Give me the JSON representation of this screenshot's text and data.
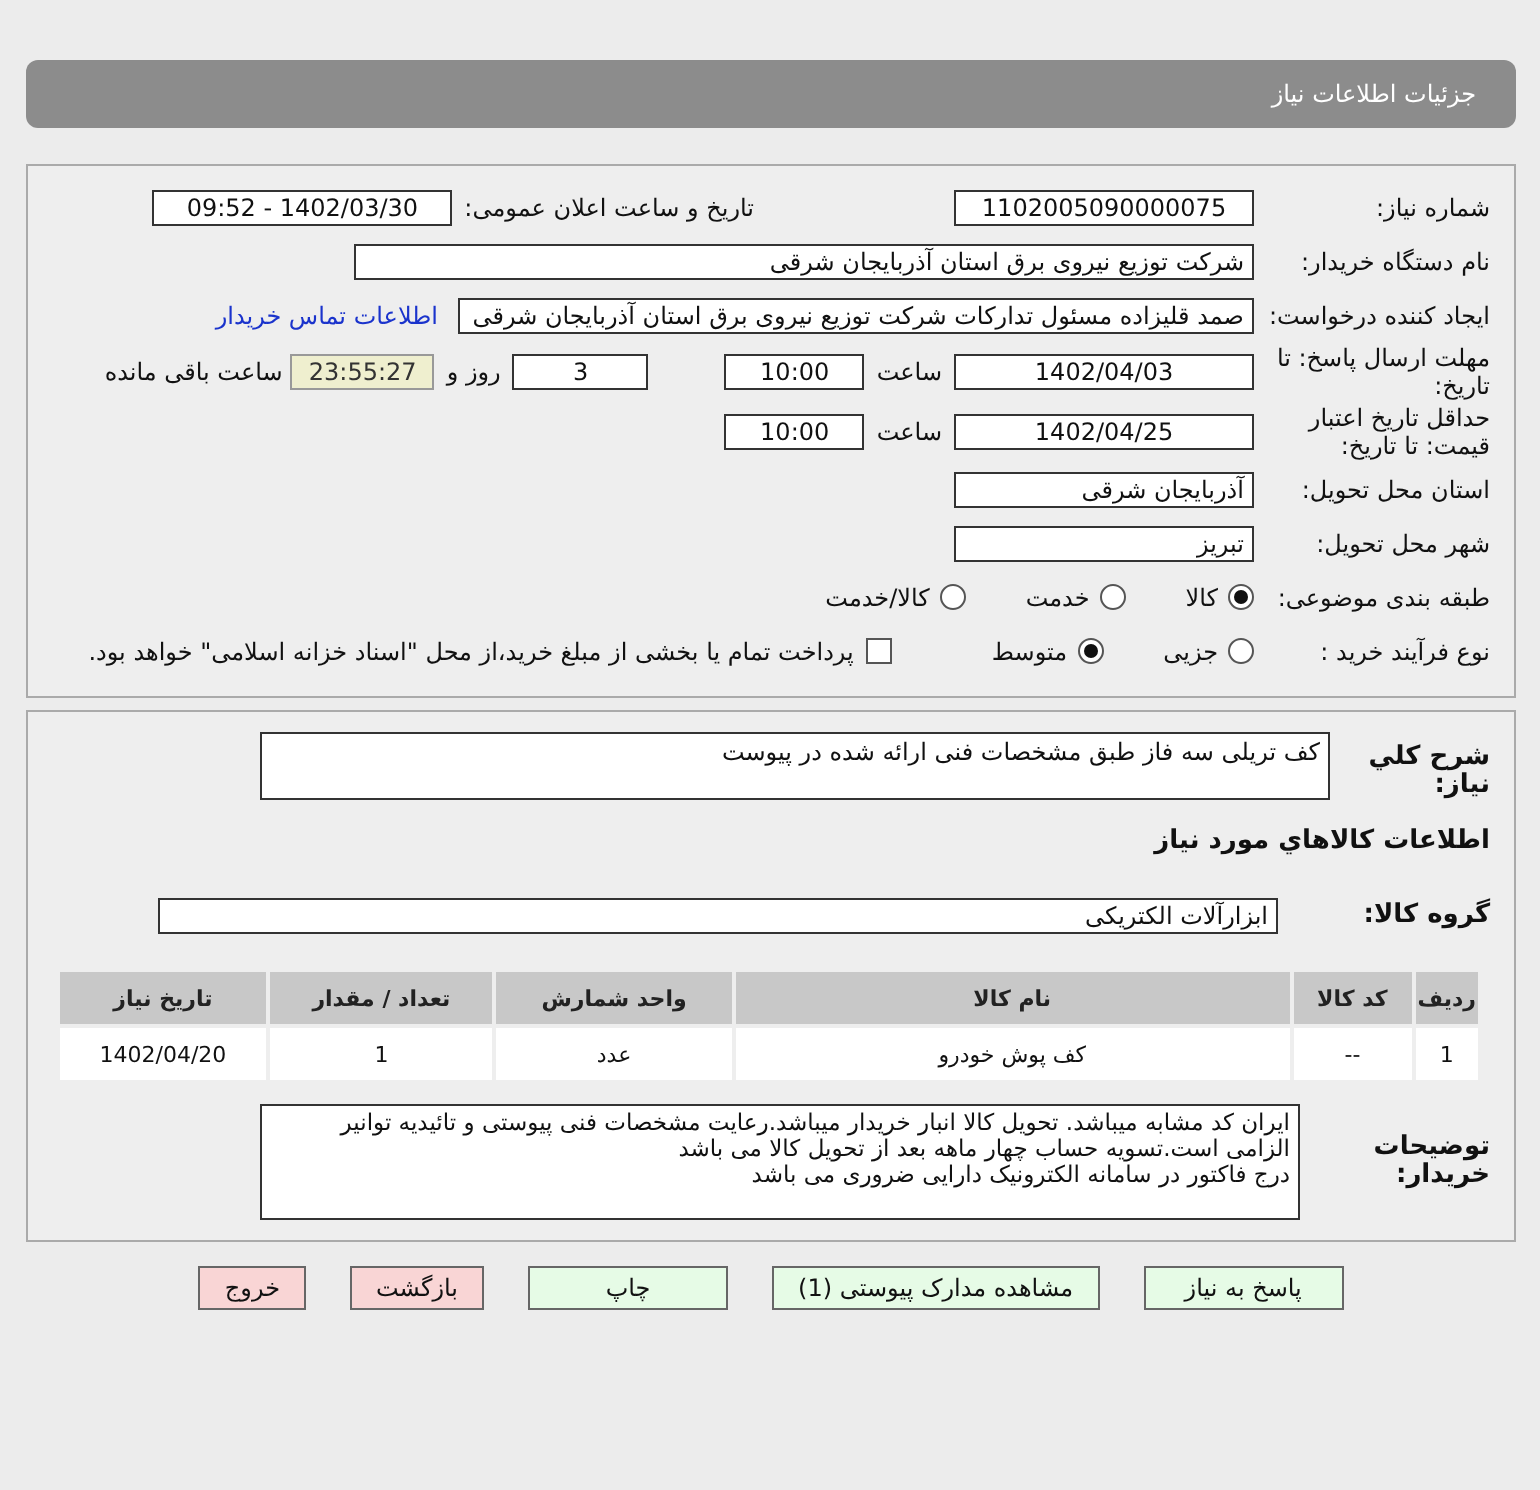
{
  "header": {
    "title": "جزئیات اطلاعات نیاز"
  },
  "need_number": {
    "label": "شماره نیاز:",
    "value": "1102005090000075"
  },
  "announce": {
    "label": "تاریخ و ساعت اعلان عمومی:",
    "value": "1402/03/30 - 09:52"
  },
  "buyer_org": {
    "label": "نام دستگاه خریدار:",
    "value": "شرکت توزیع نیروی برق استان آذربایجان شرقی"
  },
  "requester": {
    "label": "ایجاد کننده درخواست:",
    "value": "صمد  قلیزاده مسئول تدارکات شرکت توزیع نیروی برق استان آذربایجان شرقی",
    "link": "اطلاعات تماس خریدار"
  },
  "deadline": {
    "label": "مهلت ارسال پاسخ: تا تاریخ:",
    "date": "1402/04/03",
    "time_label": "ساعت",
    "time": "10:00",
    "days": "3",
    "days_label": "روز و",
    "remaining": "23:55:27",
    "remaining_label": "ساعت باقی مانده"
  },
  "validity": {
    "label": "حداقل تاریخ اعتبار قیمت: تا تاریخ:",
    "date": "1402/04/25",
    "time_label": "ساعت",
    "time": "10:00"
  },
  "province": {
    "label": "استان محل تحویل:",
    "value": "آذربایجان شرقی"
  },
  "city": {
    "label": "شهر محل تحویل:",
    "value": "تبریز"
  },
  "category": {
    "label": "طبقه بندی موضوعی:",
    "options": [
      {
        "label": "کالا",
        "selected": true
      },
      {
        "label": "خدمت",
        "selected": false
      },
      {
        "label": "کالا/خدمت",
        "selected": false
      }
    ]
  },
  "process": {
    "label": "نوع فرآیند خرید :",
    "options": [
      {
        "label": "جزیی",
        "selected": false
      },
      {
        "label": "متوسط",
        "selected": true
      }
    ],
    "payment": {
      "checked": false,
      "label": "پرداخت تمام یا بخشی از مبلغ خرید،از محل \"اسناد خزانه اسلامی\" خواهد بود."
    }
  },
  "description": {
    "label": "شرح كلي نياز:",
    "value": "کف تریلی سه فاز طبق مشخصات فنی ارائه شده در پیوست"
  },
  "goods": {
    "title": "اطلاعات كالاهاي مورد نياز",
    "group_label": "گروه کالا:",
    "group_value": "ابزارآلات الکتریکی"
  },
  "table": {
    "columns": [
      "ردیف",
      "کد کالا",
      "نام کالا",
      "واحد شمارش",
      "تعداد / مقدار",
      "تاریخ نیاز"
    ],
    "rows": [
      [
        "1",
        "--",
        "کف پوش خودرو",
        "عدد",
        "1",
        "1402/04/20"
      ]
    ]
  },
  "buyer_notes": {
    "label": "توضیحات خریدار:",
    "lines": [
      "ایران کد مشابه میباشد. تحویل کالا انبار خریدار میباشد.رعایت مشخصات فنی پیوستی و تائیدیه توانیر الزامی است.تسویه حساب چهار ماهه بعد از تحویل کالا می باشد",
      "درج فاکتور در سامانه الکترونیک دارایی ضروری می باشد"
    ]
  },
  "buttons": [
    {
      "label": "پاسخ به نیاز",
      "kind": "green"
    },
    {
      "label": "مشاهده مدارک پیوستی (1)",
      "kind": "green"
    },
    {
      "label": "چاپ",
      "kind": "green"
    },
    {
      "label": "بازگشت",
      "kind": "red"
    },
    {
      "label": "خروج",
      "kind": "red"
    }
  ]
}
